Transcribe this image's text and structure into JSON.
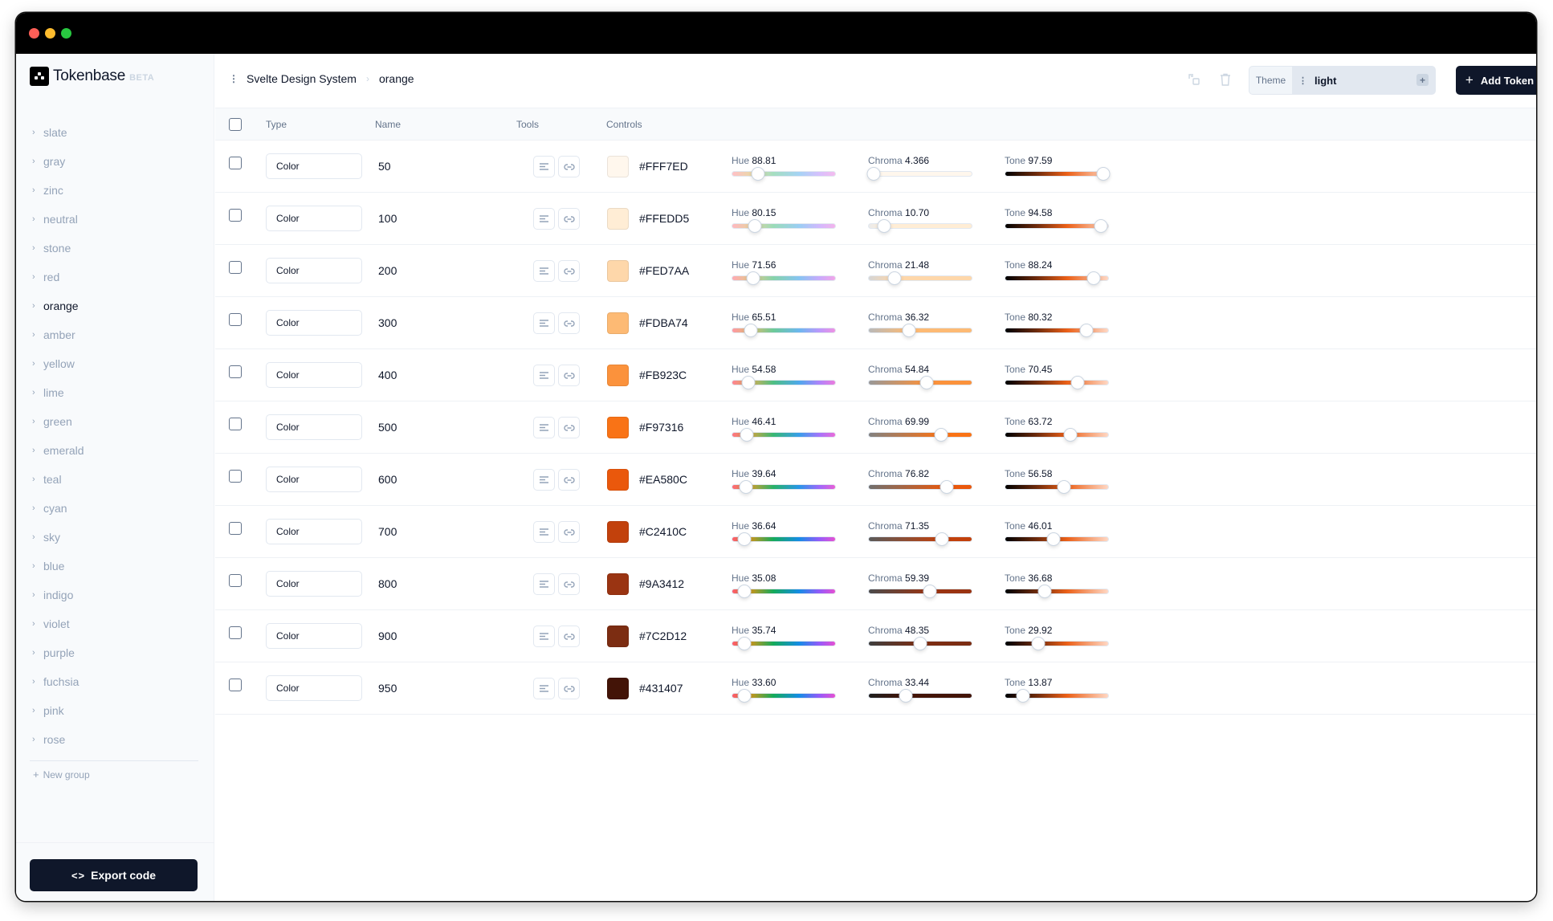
{
  "window": {
    "traffic_lights": [
      {
        "name": "close",
        "color": "#FF5F57"
      },
      {
        "name": "minimize",
        "color": "#FEBC2E"
      },
      {
        "name": "zoom",
        "color": "#28C840"
      }
    ]
  },
  "app": {
    "name": "Tokenbase",
    "badge": "BETA",
    "logo_icon": "tokenbase-logo-icon"
  },
  "sidebar": {
    "groups": [
      {
        "label": "slate",
        "active": false
      },
      {
        "label": "gray",
        "active": false
      },
      {
        "label": "zinc",
        "active": false
      },
      {
        "label": "neutral",
        "active": false
      },
      {
        "label": "stone",
        "active": false
      },
      {
        "label": "red",
        "active": false
      },
      {
        "label": "orange",
        "active": true
      },
      {
        "label": "amber",
        "active": false
      },
      {
        "label": "yellow",
        "active": false
      },
      {
        "label": "lime",
        "active": false
      },
      {
        "label": "green",
        "active": false
      },
      {
        "label": "emerald",
        "active": false
      },
      {
        "label": "teal",
        "active": false
      },
      {
        "label": "cyan",
        "active": false
      },
      {
        "label": "sky",
        "active": false
      },
      {
        "label": "blue",
        "active": false
      },
      {
        "label": "indigo",
        "active": false
      },
      {
        "label": "violet",
        "active": false
      },
      {
        "label": "purple",
        "active": false
      },
      {
        "label": "fuchsia",
        "active": false
      },
      {
        "label": "pink",
        "active": false
      },
      {
        "label": "rose",
        "active": false
      }
    ],
    "new_group_label": "New group",
    "export_label": "Export code",
    "export_icon": "code-brackets-icon"
  },
  "topbar": {
    "breadcrumb": [
      "Svelte Design System",
      "orange"
    ],
    "icons": [
      "duplicate-icon",
      "trash-icon"
    ],
    "theme_label": "Theme",
    "theme_value": "light",
    "add_token_label": "Add Token"
  },
  "table": {
    "columns": [
      "Type",
      "Name",
      "Tools",
      "Controls"
    ],
    "slider_labels": {
      "hue": "Hue",
      "chroma": "Chroma",
      "tone": "Tone"
    },
    "rows": [
      {
        "type": "Color",
        "name": "50",
        "hex": "#FFF7ED",
        "hue": "88.81",
        "chroma": "4.366",
        "tone": "97.59",
        "hue_pos": 0.25,
        "chroma_pos": 0.05,
        "tone_pos": 0.95
      },
      {
        "type": "Color",
        "name": "100",
        "hex": "#FFEDD5",
        "hue": "80.15",
        "chroma": "10.70",
        "tone": "94.58",
        "hue_pos": 0.22,
        "chroma_pos": 0.15,
        "tone_pos": 0.93
      },
      {
        "type": "Color",
        "name": "200",
        "hex": "#FED7AA",
        "hue": "71.56",
        "chroma": "21.48",
        "tone": "88.24",
        "hue_pos": 0.2,
        "chroma_pos": 0.25,
        "tone_pos": 0.86
      },
      {
        "type": "Color",
        "name": "300",
        "hex": "#FDBA74",
        "hue": "65.51",
        "chroma": "36.32",
        "tone": "80.32",
        "hue_pos": 0.18,
        "chroma_pos": 0.39,
        "tone_pos": 0.79
      },
      {
        "type": "Color",
        "name": "400",
        "hex": "#FB923C",
        "hue": "54.58",
        "chroma": "54.84",
        "tone": "70.45",
        "hue_pos": 0.16,
        "chroma_pos": 0.56,
        "tone_pos": 0.7
      },
      {
        "type": "Color",
        "name": "500",
        "hex": "#F97316",
        "hue": "46.41",
        "chroma": "69.99",
        "tone": "63.72",
        "hue_pos": 0.14,
        "chroma_pos": 0.7,
        "tone_pos": 0.63
      },
      {
        "type": "Color",
        "name": "600",
        "hex": "#EA580C",
        "hue": "39.64",
        "chroma": "76.82",
        "tone": "56.58",
        "hue_pos": 0.13,
        "chroma_pos": 0.76,
        "tone_pos": 0.57
      },
      {
        "type": "Color",
        "name": "700",
        "hex": "#C2410C",
        "hue": "36.64",
        "chroma": "71.35",
        "tone": "46.01",
        "hue_pos": 0.12,
        "chroma_pos": 0.71,
        "tone_pos": 0.47
      },
      {
        "type": "Color",
        "name": "800",
        "hex": "#9A3412",
        "hue": "35.08",
        "chroma": "59.39",
        "tone": "36.68",
        "hue_pos": 0.12,
        "chroma_pos": 0.59,
        "tone_pos": 0.38
      },
      {
        "type": "Color",
        "name": "900",
        "hex": "#7C2D12",
        "hue": "35.74",
        "chroma": "48.35",
        "tone": "29.92",
        "hue_pos": 0.12,
        "chroma_pos": 0.5,
        "tone_pos": 0.32
      },
      {
        "type": "Color",
        "name": "950",
        "hex": "#431407",
        "hue": "33.60",
        "chroma": "33.44",
        "tone": "13.87",
        "hue_pos": 0.12,
        "chroma_pos": 0.36,
        "tone_pos": 0.17
      }
    ]
  }
}
